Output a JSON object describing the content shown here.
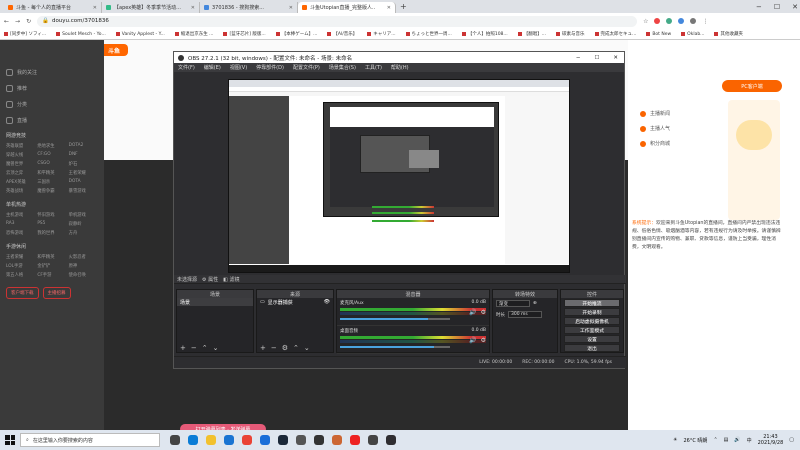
{
  "browser": {
    "tabs": [
      {
        "label": "斗鱼 - 每个人的直播平台",
        "color": "#f60"
      },
      {
        "label": "【apex英雄】冬季季节活动...",
        "color": "#3b8"
      },
      {
        "label": "3701836 - 搜狗搜索...",
        "color": "#48d"
      },
      {
        "label": "斗鱼Utopian直播_完整版人..",
        "color": "#f60",
        "active": true
      }
    ],
    "new_tab": "+",
    "window_controls": {
      "minimize": "−",
      "maximize": "☐",
      "close": "✕"
    },
    "url": "douyu.com/3701836",
    "bookmarks": [
      "[同步中] ソフィ...",
      "Soulet Mesch - Yo...",
      "Vanity Applest - Y...",
      "缩退出京东生 ...",
      "[蓝牙芯片] 版版...",
      "【本棒ゲーム】...",
      "【Al/音乐】",
      "キャリア...",
      "ちょっと世界一周...",
      "【个人】拍照108...",
      "【翻唱】...",
      "碳素与音乐",
      "完成太郎セキュ...",
      "Bot New",
      "Oklab...",
      "其他收藏夹"
    ]
  },
  "douyu": {
    "logo": "斗鱼",
    "sidebar_top": [
      "我的关注",
      "推荐",
      "分类",
      "直播"
    ],
    "sidebar_sections": [
      {
        "title": "网游竞技",
        "items": [
          "英雄联盟",
          "绝地求生",
          "DOTA2",
          "穿越火线",
          "CF:GO",
          "DNF",
          "魔兽世界",
          "CSGO",
          "炉石",
          "云顶之弈",
          "和平精英",
          "王者荣耀",
          "APEX英雄",
          "三国杀",
          "DOTA",
          "英雄战场",
          "魔兽争霸",
          "暴雪游戏"
        ]
      },
      {
        "title": "单机热游",
        "items": [
          "主机游戏",
          "怀旧游戏",
          "单机游戏",
          "RA3",
          "PS5",
          "寂静岭",
          "恐怖游戏",
          "我的世界",
          "方舟"
        ]
      },
      {
        "title": "手游休闲",
        "items": [
          "王者荣耀",
          "和平精英",
          "火影忍者",
          "LOL手游",
          "金铲铲",
          "原神",
          "第五人格",
          "CF手游",
          "使命召唤"
        ]
      }
    ],
    "sidebar_bottom": [
      "客户端下载",
      "主播招募"
    ],
    "right_panel": {
      "download_button": "PC客户端",
      "rows": [
        "主播新闻",
        "主播人气",
        "积分商城"
      ],
      "notice_title": "系统提示：",
      "notice_body": "欢迎来到斗鱼Utopian的直播间，直播间内严禁出现违法违规、低俗色情、吸烟酗酒等内容，若有违规行为请及时举报。请谨慎辨别直播间内宣传的购物、兼职、贷款等信息，谨防上当受骗，理性消费，文明观看。"
    },
    "bottom_pill": "打开弹幕列表 · 发送弹幕"
  },
  "obs": {
    "title": "OBS 27.2.1 (32 bit, windows) - 配置文件: 未命名 - 场景: 未命名",
    "menu": [
      "文件(F)",
      "编辑(E)",
      "视图(V)",
      "停靠部件(D)",
      "配置文件(P)",
      "场景集合(S)",
      "工具(T)",
      "帮助(H)"
    ],
    "dock_title": "未选择源",
    "dock_tabs": [
      "属性",
      "滤镜"
    ],
    "scenes": {
      "header": "场景",
      "items": [
        "场景"
      ]
    },
    "sources": {
      "header": "来源",
      "items": [
        "显示器捕获"
      ]
    },
    "mixer": {
      "header": "混音器",
      "channels": [
        {
          "name": "麦克风/Aux",
          "db": "0.0 dB",
          "level": 0.8
        },
        {
          "name": "桌面音频",
          "db": "0.0 dB",
          "level": 0.85
        }
      ]
    },
    "transitions": {
      "header": "转场特效",
      "type": "渐变",
      "duration_label": "时长",
      "duration": "300 ms"
    },
    "controls": {
      "header": "控件",
      "buttons": [
        "开始推流",
        "开始录制",
        "启动虚拟摄像机",
        "工作室模式",
        "设置",
        "退出"
      ]
    },
    "status": {
      "live": "LIVE: 00:00:00",
      "rec": "REC: 00:00:00",
      "cpu": "CPU: 1.0%, 59.94 fps"
    }
  },
  "taskbar": {
    "search_placeholder": "在这里输入你要搜索的内容",
    "apps": [
      {
        "name": "task-view",
        "color": "#444"
      },
      {
        "name": "edge",
        "color": "#0a7cd6"
      },
      {
        "name": "explorer",
        "color": "#f2c12e"
      },
      {
        "name": "store",
        "color": "#1a74d2"
      },
      {
        "name": "chrome",
        "color": "#ea4335"
      },
      {
        "name": "mail",
        "color": "#1a6ed8"
      },
      {
        "name": "steam",
        "color": "#1b2838"
      },
      {
        "name": "pinned-1",
        "color": "#555"
      },
      {
        "name": "pinned-2",
        "color": "#333"
      },
      {
        "name": "pinned-3",
        "color": "#c63"
      },
      {
        "name": "pinned-4",
        "color": "#e22"
      },
      {
        "name": "pinned-5",
        "color": "#444"
      },
      {
        "name": "obs",
        "color": "#302e31"
      }
    ],
    "weather": "26°C 晴朗",
    "time": "21:43",
    "date": "2021/9/28"
  }
}
